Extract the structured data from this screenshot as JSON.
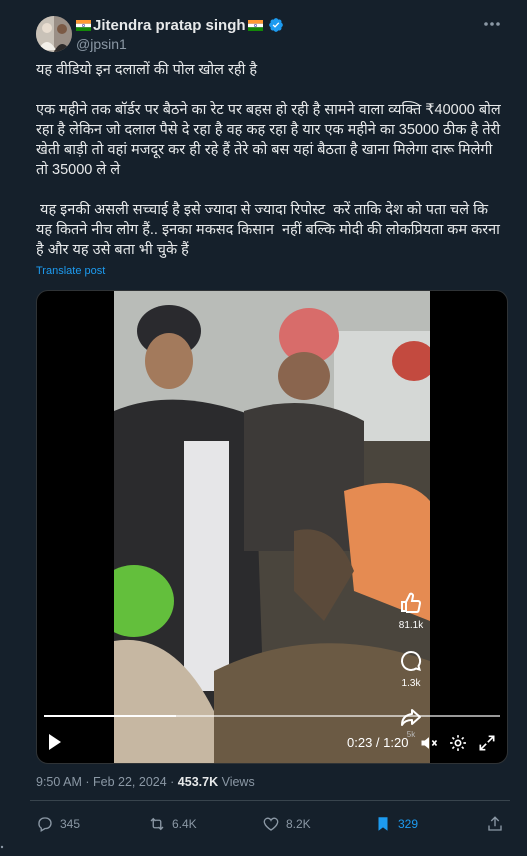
{
  "author": {
    "name": "Jitendra pratap singh",
    "handle": "@jpsin1"
  },
  "menu_icon": "more-horizontal-icon",
  "post": {
    "text": "यह वीडियो इन दलालों की पोल खोल रही है\n\nएक महीने तक बॉर्डर पर बैठने का रेट पर बहस हो रही है सामने वाला व्यक्ति ₹40000 बोल रहा है लेकिन जो दलाल पैसे दे रहा है वह कह रहा है यार एक महीने का 35000 ठीक है तेरी खेती बाड़ी तो वहां मजदूर कर ही रहे हैं तेरे को बस यहां बैठता है खाना मिलेगा दारू मिलेगी तो 35000 ले ले\n\n यह इनकी असली सच्चाई है इसे ज्यादा से ज्यादा रिपोस्ट  करें ताकि देश को पता चले कि यह कितने नीच लोग हैं.. इनका मकसद किसान  नहीं बल्कि मोदी की लोकप्रियता कम करना है और यह उसे बता भी चुके हैं",
    "translate_label": "Translate post"
  },
  "video": {
    "time": "0:23 / 1:20",
    "progress": 0.29,
    "side": {
      "likes": "81.1k",
      "comments": "1.3k",
      "shares": "5k"
    }
  },
  "meta": {
    "time": "9:50 AM",
    "date": "Feb 22, 2024",
    "views": "453.7K",
    "views_label": "Views"
  },
  "actions": {
    "replies": "345",
    "reposts": "6.4K",
    "likes": "8.2K",
    "bookmarks": "329"
  },
  "colors": {
    "background": "#15202b",
    "accent": "#1d9bf0",
    "muted": "#8b98a5"
  }
}
